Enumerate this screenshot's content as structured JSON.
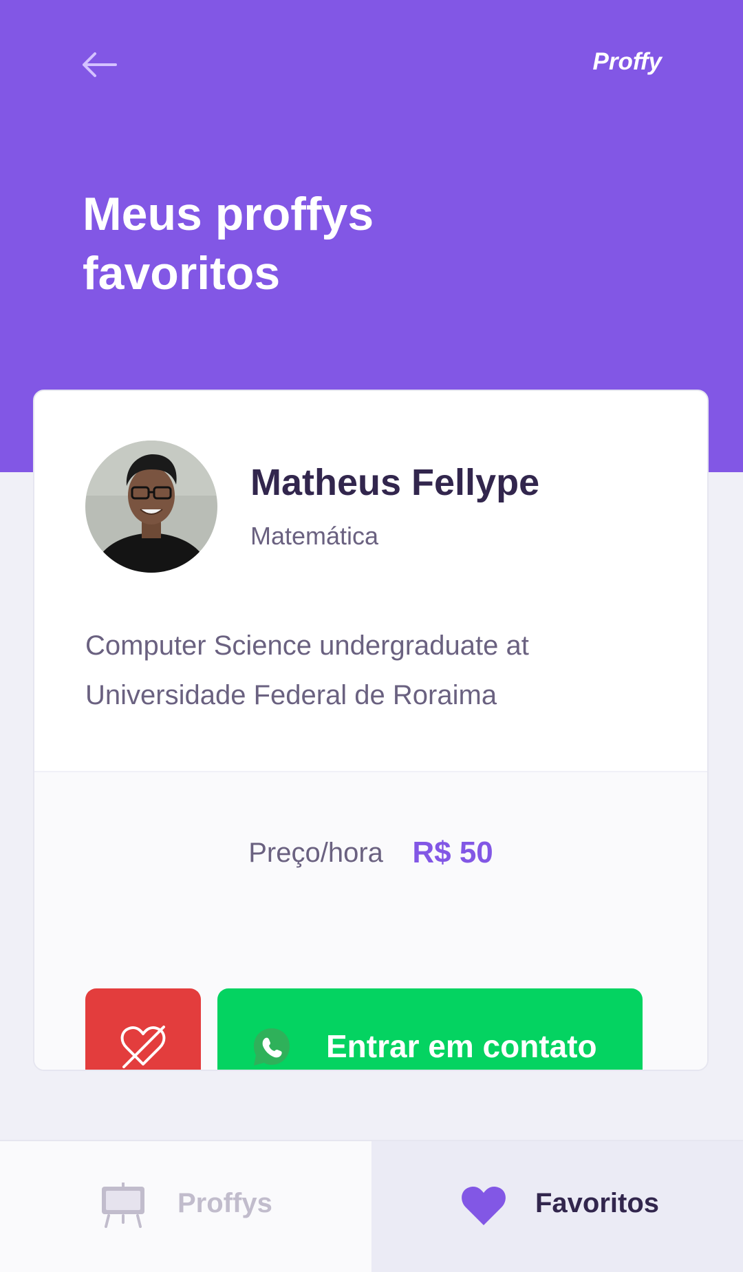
{
  "header": {
    "logo": "Proffy",
    "title": "Meus proffys favoritos",
    "back_icon": "arrow-left-icon"
  },
  "teacher": {
    "name": "Matheus Fellype",
    "subject": "Matemática",
    "bio": "Computer Science undergraduate at Universidade Federal de Roraima",
    "price_label": "Preço/hora",
    "price_value": "R$ 50",
    "unfavorite_icon": "heart-outline-slashed-icon",
    "contact_icon": "whatsapp-icon",
    "contact_label": "Entrar em contato"
  },
  "tabbar": {
    "tabs": [
      {
        "label": "Proffys",
        "icon": "easel-icon",
        "active": false
      },
      {
        "label": "Favoritos",
        "icon": "heart-icon",
        "active": true
      }
    ]
  },
  "colors": {
    "primary": "#8257E5",
    "danger": "#E33D3D",
    "success": "#04D361",
    "title_text": "#32264D",
    "body_text": "#6A6180"
  }
}
